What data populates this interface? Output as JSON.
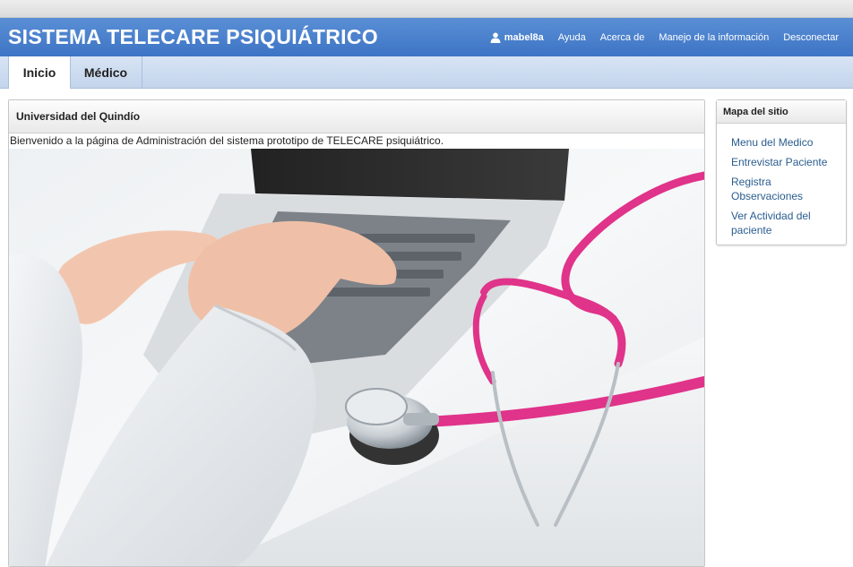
{
  "header": {
    "title": "SISTEMA TELECARE PSIQUIÁTRICO",
    "user": "mabel8a",
    "links": [
      "Ayuda",
      "Acerca de",
      "Manejo de la información",
      "Desconectar"
    ]
  },
  "tabs": [
    {
      "label": "Inicio",
      "active": true
    },
    {
      "label": "Médico",
      "active": false
    }
  ],
  "main": {
    "panel_title": "Universidad del Quindío",
    "welcome": "Bienvenido a la página de Administración del sistema prototipo de TELECARE psiquiátrico.",
    "hero_image": "doctor typing on laptop with pink stethoscope"
  },
  "sitemap": {
    "title": "Mapa del sitio",
    "links": [
      "Menu del Medico",
      "Entrevistar Paciente",
      "Registra Observaciones",
      "Ver Actividad del paciente"
    ]
  },
  "colors": {
    "header_blue": "#3d74c4",
    "tab_bar": "#c3d4ec",
    "link": "#2a5d8f",
    "stethoscope": "#e0338a"
  },
  "icons": {
    "user": "user-icon"
  }
}
